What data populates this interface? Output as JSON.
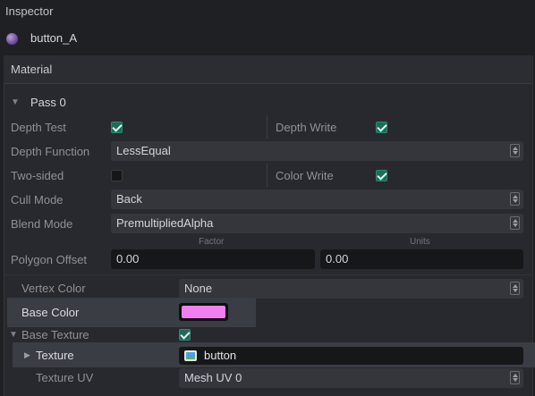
{
  "inspector": {
    "title": "Inspector"
  },
  "asset": {
    "name": "button_A"
  },
  "material": {
    "header": "Material",
    "pass": {
      "label": "Pass 0",
      "depth_test": {
        "label": "Depth Test",
        "checked": true
      },
      "depth_write": {
        "label": "Depth Write",
        "checked": true
      },
      "depth_function": {
        "label": "Depth Function",
        "value": "LessEqual"
      },
      "two_sided": {
        "label": "Two-sided",
        "checked": false
      },
      "color_write": {
        "label": "Color Write",
        "checked": true
      },
      "cull_mode": {
        "label": "Cull Mode",
        "value": "Back"
      },
      "blend_mode": {
        "label": "Blend Mode",
        "value": "PremultipliedAlpha"
      },
      "polygon_offset": {
        "label": "Polygon Offset",
        "factor_caption": "Factor",
        "units_caption": "Units",
        "factor": "0.00",
        "units": "0.00"
      }
    },
    "props": {
      "vertex_color": {
        "label": "Vertex Color",
        "value": "None"
      },
      "base_color": {
        "label": "Base Color",
        "color": "#f27ef0"
      },
      "base_texture": {
        "label": "Base Texture",
        "checked": true
      },
      "texture": {
        "label": "Texture",
        "value": "button"
      },
      "texture_uv": {
        "label": "Texture UV",
        "value": "Mesh UV 0"
      }
    }
  }
}
